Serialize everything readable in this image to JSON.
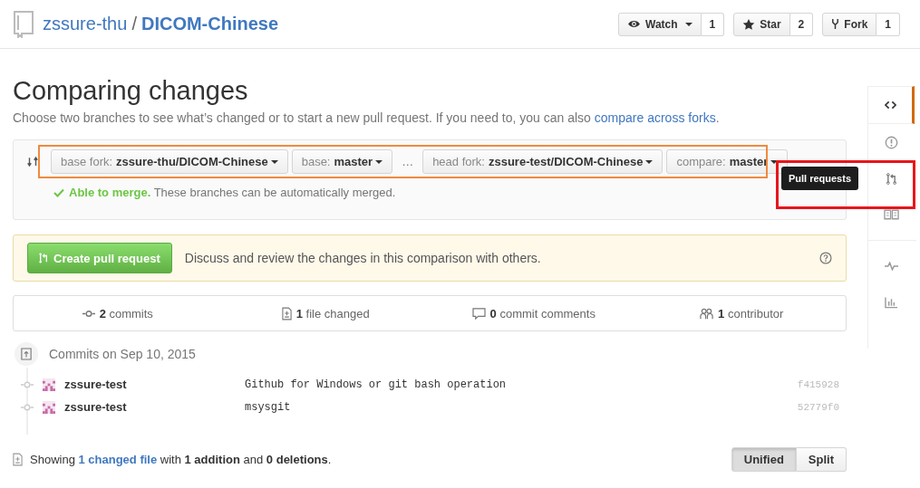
{
  "header": {
    "owner": "zssure-thu",
    "separator": "/",
    "repo": "DICOM-Chinese",
    "actions": [
      {
        "kind": "watch",
        "label": "Watch",
        "count": "1",
        "caret": true
      },
      {
        "kind": "star",
        "label": "Star",
        "count": "2",
        "caret": false
      },
      {
        "kind": "fork",
        "label": "Fork",
        "count": "1",
        "caret": false
      }
    ]
  },
  "title": "Comparing changes",
  "description": {
    "text": "Choose two branches to see what’s changed or to start a new pull request. If you need to, you can also ",
    "link": "compare across forks",
    "end": "."
  },
  "range": {
    "highlighted": true,
    "base": [
      {
        "label": "base fork:",
        "value": "zssure-thu/DICOM-Chinese"
      },
      {
        "label": "base:",
        "value": "master"
      }
    ],
    "ellipsis": "…",
    "head": [
      {
        "label": "head fork:",
        "value": "zssure-test/DICOM-Chinese"
      },
      {
        "label": "compare:",
        "value": "master"
      }
    ]
  },
  "merge_status": {
    "ok": true,
    "title": "Able to merge.",
    "text": "These branches can be automatically merged."
  },
  "create": {
    "button": "Create pull request",
    "text": "Discuss and review the changes in this comparison with others."
  },
  "stats": [
    {
      "kind": "commits",
      "text": "**2** commits"
    },
    {
      "kind": "files",
      "text": "**1** file changed"
    },
    {
      "kind": "comments",
      "text": "**0** commit comments"
    },
    {
      "kind": "contributors",
      "text": "**1** contributor"
    }
  ],
  "commits": {
    "date": "Commits on Sep 10, 2015",
    "rows": [
      {
        "author": "zssure-test",
        "message": "Github for Windows or git bash operation",
        "sha": "f415928"
      },
      {
        "author": "zssure-test",
        "message": "msysgit",
        "sha": "52779f0"
      }
    ]
  },
  "summary": {
    "before": "Showing ",
    "link": "1 changed file",
    "after": " with **1 addition** and **0 deletions**."
  },
  "view_toggle": [
    {
      "label": "Unified",
      "selected": true
    },
    {
      "label": "Split",
      "selected": false
    }
  ],
  "sidebar": [
    {
      "kind": "code",
      "selected": true,
      "divider_before": false
    },
    {
      "kind": "issues",
      "selected": false,
      "divider_before": false
    },
    {
      "kind": "pulls",
      "selected": false,
      "divider_before": false,
      "tooltip": "Pull requests",
      "highlighted": true
    },
    {
      "kind": "wiki",
      "selected": false,
      "divider_before": false
    },
    {
      "kind": "pulse",
      "selected": false,
      "divider_before": true
    },
    {
      "kind": "graphs",
      "selected": false,
      "divider_before": false
    }
  ]
}
